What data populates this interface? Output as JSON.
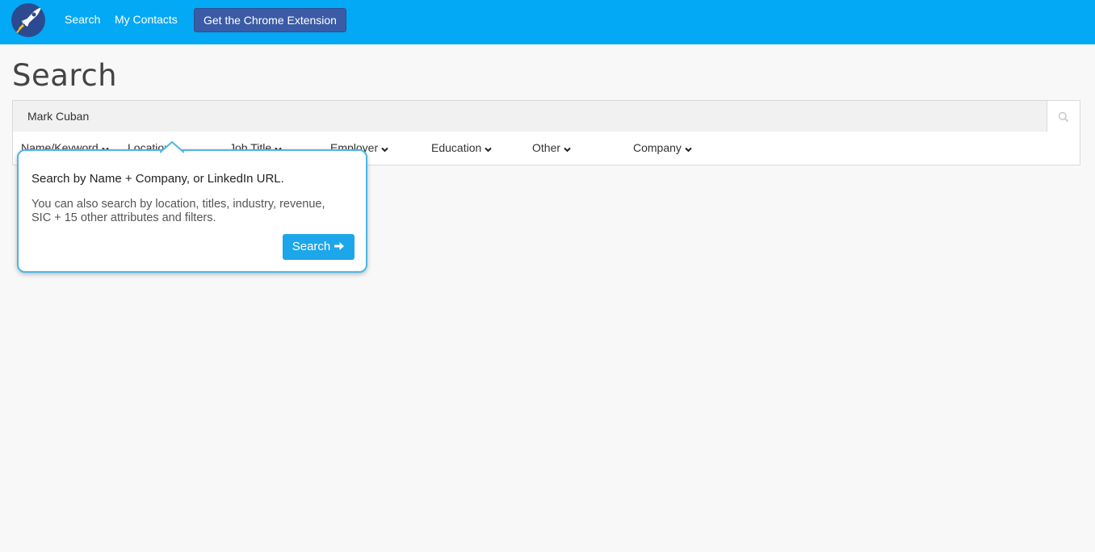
{
  "nav": {
    "links": [
      {
        "label": "Search"
      },
      {
        "label": "My Contacts"
      }
    ],
    "extension_button": "Get the Chrome Extension",
    "logo_icon": "rocket-icon"
  },
  "page": {
    "title": "Search"
  },
  "search": {
    "value": "Mark Cuban",
    "icon": "search-icon"
  },
  "filters": [
    {
      "label": "Name/Keyword"
    },
    {
      "label": "Location"
    },
    {
      "label": "Job Title"
    },
    {
      "label": "Employer"
    },
    {
      "label": "Education"
    },
    {
      "label": "Other"
    },
    {
      "label": "Company"
    }
  ],
  "popover": {
    "title": "Search by Name + Company, or LinkedIn URL.",
    "text": "You can also search by location, titles, industry, revenue, SIC + 15 other attributes and filters.",
    "button": "Search"
  },
  "colors": {
    "topbar": "#03a9f4",
    "extension_button": "#3b5ba6",
    "popover_border": "#4db6e8",
    "primary_button": "#1da6ea"
  }
}
